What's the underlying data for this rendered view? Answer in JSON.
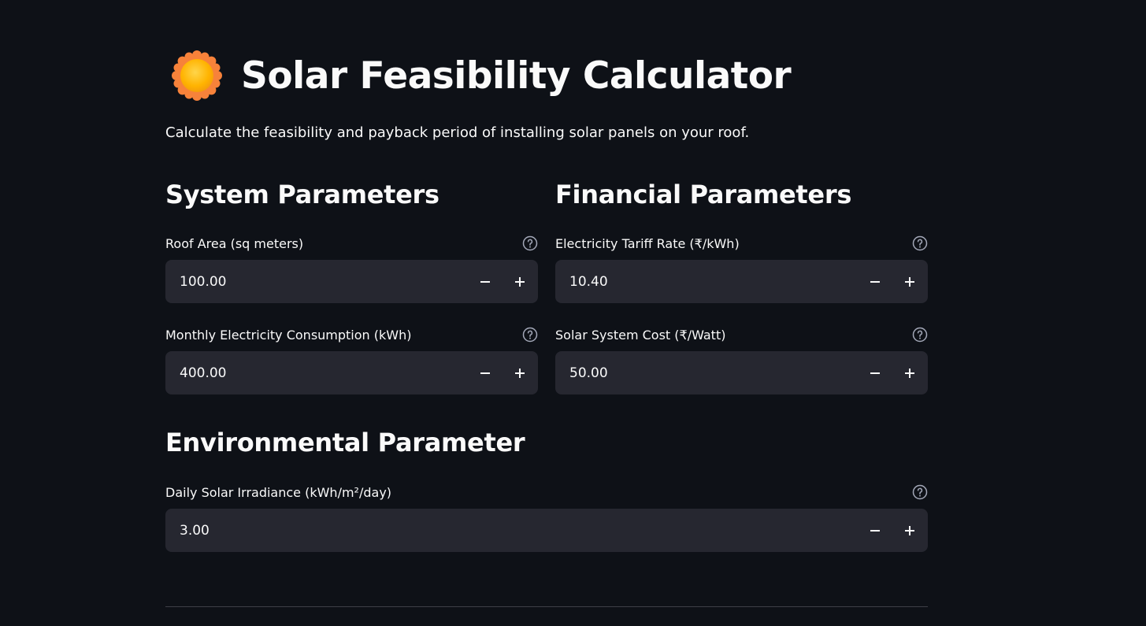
{
  "header": {
    "title": "Solar Feasibility Calculator",
    "icon": "sun-icon",
    "subtitle": "Calculate the feasibility and payback period of installing solar panels on your roof."
  },
  "system_parameters": {
    "heading": "System Parameters",
    "roof_area": {
      "label": "Roof Area (sq meters)",
      "value": "100.00"
    },
    "monthly_consumption": {
      "label": "Monthly Electricity Consumption (kWh)",
      "value": "400.00"
    }
  },
  "financial_parameters": {
    "heading": "Financial Parameters",
    "tariff_rate": {
      "label": "Electricity Tariff Rate (₹/kWh)",
      "value": "10.40"
    },
    "system_cost": {
      "label": "Solar System Cost (₹/Watt)",
      "value": "50.00"
    }
  },
  "environmental_parameter": {
    "heading": "Environmental Parameter",
    "irradiance": {
      "label": "Daily Solar Irradiance (kWh/m²/day)",
      "value": "3.00"
    }
  },
  "icons": {
    "help": "help-circle-icon",
    "decrement": "minus-icon",
    "increment": "plus-icon"
  },
  "colors": {
    "background": "#0e1117",
    "input_background": "#262730",
    "text": "#fafafa",
    "help_icon": "#a3a8b8",
    "divider": "#3d3f47"
  }
}
